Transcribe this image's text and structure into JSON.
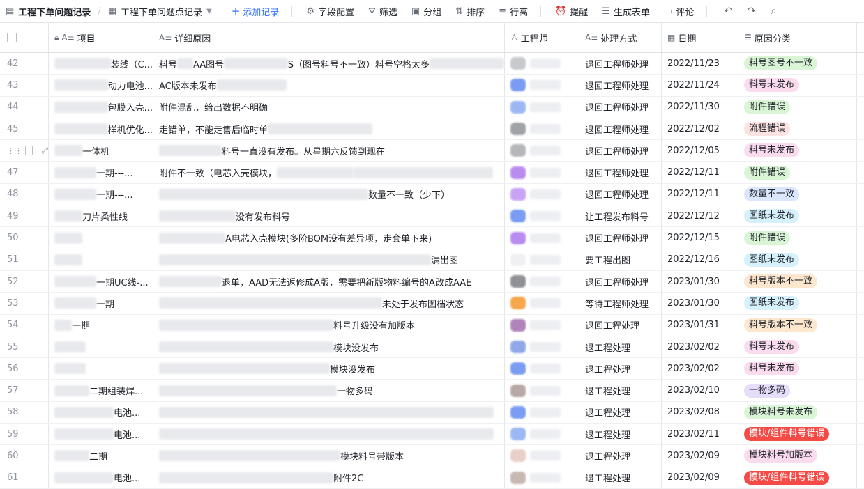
{
  "toolbar": {
    "doc_title": "工程下单问题记录",
    "view_title": "工程下单问题点记录",
    "add_label": "添加记录",
    "field_config": "字段配置",
    "filter": "筛选",
    "group": "分组",
    "sort": "排序",
    "row_height": "行高",
    "remind": "提醒",
    "gen_form": "生成表单",
    "comment": "评论"
  },
  "columns": {
    "project": "项目",
    "detail": "详细原因",
    "engineer": "工程师",
    "method": "处理方式",
    "date": "日期",
    "category": "原因分类"
  },
  "rows": [
    {
      "num": "42",
      "p_pre": 110,
      "p_text": "装线（C...",
      "d_pre": 30,
      "d_text": "料号",
      "d_mid": 120,
      "d_text2": "AA图号",
      "d_mid2": 140,
      "d_text3": "S（图号料号不一致）料号空格太多",
      "av": "#c8c9cc",
      "method": "退回工程师处理",
      "date": "2022/11/23",
      "cat": "料号图号不一致",
      "cat_bg": "#d9f5d6",
      "cat_fg": "#1f2329"
    },
    {
      "num": "43",
      "p_pre": 110,
      "p_text": "动力电池...",
      "d_pre": 0,
      "d_text": "",
      "d_mid": 100,
      "d_text2": "AC版本未发布",
      "d_mid2": 0,
      "d_text3": "",
      "av": "#7a9cf2",
      "method": "退回工程师处理",
      "date": "2022/11/24",
      "cat": "料号未发布",
      "cat_bg": "#fbdbee",
      "cat_fg": "#1f2329"
    },
    {
      "num": "44",
      "p_pre": 100,
      "p_text": "包膜入壳...",
      "d_pre": 0,
      "d_text": "附件混乱，给出数据不明确",
      "d_mid": 0,
      "d_text2": "",
      "d_mid2": 0,
      "d_text3": "",
      "av": "#9bb8f5",
      "method": "退回工程师处理",
      "date": "2022/11/30",
      "cat": "附件错误",
      "cat_bg": "#d9f5d6",
      "cat_fg": "#1f2329"
    },
    {
      "num": "45",
      "p_pre": 110,
      "p_text": "样机优化...",
      "d_pre": 0,
      "d_text": "走错单，不能走售后临时单",
      "d_mid": 150,
      "d_text2": "",
      "d_mid2": 0,
      "d_text3": "",
      "av": "#a0a3a8",
      "method": "退回工程师处理",
      "date": "2022/12/02",
      "cat": "流程错误",
      "cat_bg": "#fde2e2",
      "cat_fg": "#1f2329"
    },
    {
      "num": "",
      "p_pre": 40,
      "p_text": "一体机",
      "d_pre": 90,
      "d_text": "",
      "d_mid": 0,
      "d_text2": "料号一直没有发布。从星期六反馈到现在",
      "d_mid2": 0,
      "d_text3": "",
      "av": "#b5b7bb",
      "method": "退回工程师处理",
      "date": "2022/12/05",
      "cat": "料号未发布",
      "cat_bg": "#fbdbee",
      "cat_fg": "#1f2329",
      "hover": true
    },
    {
      "num": "47",
      "p_pre": 60,
      "p_text": "一期---...",
      "d_pre": 0,
      "d_text": "附件不一致（",
      "d_mid": 110,
      "d_text2": "电芯入壳模块，",
      "d_mid2": 200,
      "d_text3": "",
      "av": "#b98cf0",
      "method": "退回工程师处理",
      "date": "2022/12/11",
      "cat": "附件错误",
      "cat_bg": "#d9f5d6",
      "cat_fg": "#1f2329"
    },
    {
      "num": "48",
      "p_pre": 60,
      "p_text": "一期---...",
      "d_pre": 300,
      "d_text": "",
      "d_mid": 0,
      "d_text2": "数量不一致（少下）",
      "d_mid2": 0,
      "d_text3": "",
      "av": "#c9a3f5",
      "method": "退回工程师处理",
      "date": "2022/12/11",
      "cat": "数量不一致",
      "cat_bg": "#dbe6ff",
      "cat_fg": "#1f2329"
    },
    {
      "num": "49",
      "p_pre": 40,
      "p_text": "刀片柔性线",
      "d_pre": 110,
      "d_text": "",
      "d_mid": 0,
      "d_text2": "没有发布料号",
      "d_mid2": 0,
      "d_text3": "",
      "av": "#7a9cf2",
      "method": "让工程发布料号",
      "date": "2022/12/12",
      "cat": "图纸未发布",
      "cat_bg": "#d6f1fb",
      "cat_fg": "#1f2329"
    },
    {
      "num": "50",
      "p_pre": 40,
      "p_text": "",
      "d_pre": 95,
      "d_text": "",
      "d_mid": 0,
      "d_text2": "A电芯入壳模块(多阶BOM没有差异项，走套单下来)",
      "d_mid2": 0,
      "d_text3": "",
      "av": "#b98cf0",
      "method": "退回工程师处理",
      "date": "2022/12/15",
      "cat": "附件错误",
      "cat_bg": "#d9f5d6",
      "cat_fg": "#1f2329"
    },
    {
      "num": "51",
      "p_pre": 40,
      "p_text": "",
      "d_pre": 390,
      "d_text": "",
      "d_mid": 0,
      "d_text2": "漏出图",
      "d_mid2": 0,
      "d_text3": "",
      "av": "#f0f0f2",
      "method": "要工程出图",
      "date": "2022/12/16",
      "cat": "图纸未发布",
      "cat_bg": "#d6f1fb",
      "cat_fg": "#1f2329"
    },
    {
      "num": "52",
      "p_pre": 60,
      "p_text": "一期UC线-...",
      "d_pre": 90,
      "d_text": "",
      "d_mid": 0,
      "d_text2": "退单，AAD无法返修成A版，需要把新版物料编号的A改成AAE",
      "d_mid2": 0,
      "d_text3": "",
      "av": "#8f9197",
      "method": "退回工程师处理",
      "date": "2023/01/30",
      "cat": "料号版本不一致",
      "cat_bg": "#fde7cf",
      "cat_fg": "#1f2329"
    },
    {
      "num": "53",
      "p_pre": 60,
      "p_text": "一期",
      "d_pre": 320,
      "d_text": "",
      "d_mid": 0,
      "d_text2": "未处于发布图档状态",
      "d_mid2": 0,
      "d_text3": "",
      "av": "#f5a74a",
      "method": "等待工程师处理",
      "date": "2023/01/30",
      "cat": "图纸未发布",
      "cat_bg": "#d6f1fb",
      "cat_fg": "#1f2329"
    },
    {
      "num": "54",
      "p_pre": 25,
      "p_text": "一期",
      "d_pre": 250,
      "d_text": "",
      "d_mid": 0,
      "d_text2": "料号升级没有加版本",
      "d_mid2": 0,
      "d_text3": "",
      "av": "#b084b8",
      "method": "退回工程处理",
      "date": "2023/01/31",
      "cat": "料号版本不一致",
      "cat_bg": "#fde7cf",
      "cat_fg": "#1f2329"
    },
    {
      "num": "55",
      "p_pre": 45,
      "p_text": "",
      "d_pre": 250,
      "d_text": "",
      "d_mid": 0,
      "d_text2": "模块没发布",
      "d_mid2": 0,
      "d_text3": "",
      "av": "#8fa9e8",
      "method": "退工程处理",
      "date": "2023/02/02",
      "cat": "料号未发布",
      "cat_bg": "#fbdbee",
      "cat_fg": "#1f2329"
    },
    {
      "num": "56",
      "p_pre": 45,
      "p_text": "",
      "d_pre": 245,
      "d_text": "",
      "d_mid": 0,
      "d_text2": "模块没发布",
      "d_mid2": 0,
      "d_text3": "",
      "av": "#7a9cf2",
      "method": "退工程处理",
      "date": "2023/02/02",
      "cat": "料号未发布",
      "cat_bg": "#fbdbee",
      "cat_fg": "#1f2329"
    },
    {
      "num": "57",
      "p_pre": 50,
      "p_text": "二期组装焊...",
      "d_pre": 255,
      "d_text": "",
      "d_mid": 0,
      "d_text2": "一物多码",
      "d_mid2": 0,
      "d_text3": "",
      "av": "#b8a9a6",
      "method": "退工程处理",
      "date": "2023/02/10",
      "cat": "一物多码",
      "cat_bg": "#e6ddfb",
      "cat_fg": "#1f2329"
    },
    {
      "num": "58",
      "p_pre": 85,
      "p_text": "电池...",
      "d_pre": 480,
      "d_text": "",
      "d_mid": 0,
      "d_text2": "",
      "d_mid2": 0,
      "d_text3": "",
      "av": "#7a9cf2",
      "method": "退工程处理",
      "date": "2023/02/08",
      "cat": "模块料号未发布",
      "cat_bg": "#d9f5d6",
      "cat_fg": "#1f2329"
    },
    {
      "num": "59",
      "p_pre": 85,
      "p_text": "电池...",
      "d_pre": 480,
      "d_text": "",
      "d_mid": 0,
      "d_text2": "",
      "d_mid2": 0,
      "d_text3": "",
      "av": "#9bb8f5",
      "method": "退工程处理",
      "date": "2023/02/11",
      "cat": "模块/组件料号错误",
      "cat_bg": "#f54a45",
      "cat_fg": "#ffffff"
    },
    {
      "num": "60",
      "p_pre": 50,
      "p_text": "二期",
      "d_pre": 260,
      "d_text": "",
      "d_mid": 0,
      "d_text2": "模块料号带版本",
      "d_mid2": 0,
      "d_text3": "",
      "av": "#e8cfc8",
      "method": "退工程处理",
      "date": "2023/02/09",
      "cat": "模块料号加版本",
      "cat_bg": "#fbdbee",
      "cat_fg": "#1f2329"
    },
    {
      "num": "61",
      "p_pre": 85,
      "p_text": "电池...",
      "d_pre": 250,
      "d_text": "",
      "d_mid": 0,
      "d_text2": "附件2C",
      "d_mid2": 0,
      "d_text3": "",
      "av": "#c8b8b4",
      "method": "退工程处理",
      "date": "2023/02/09",
      "cat": "模块/组件料号错误",
      "cat_bg": "#f54a45",
      "cat_fg": "#ffffff"
    }
  ],
  "icons": {
    "doc": "table-icon",
    "view": "grid-view-icon",
    "add": "plus-icon",
    "field": "gear-icon",
    "filter": "filter-icon",
    "group": "group-icon",
    "sort": "sort-icon",
    "row_height": "row-height-icon",
    "remind": "alarm-icon",
    "form": "form-icon",
    "comment": "comment-icon",
    "undo": "undo-icon",
    "redo": "redo-icon",
    "search": "search-icon"
  }
}
